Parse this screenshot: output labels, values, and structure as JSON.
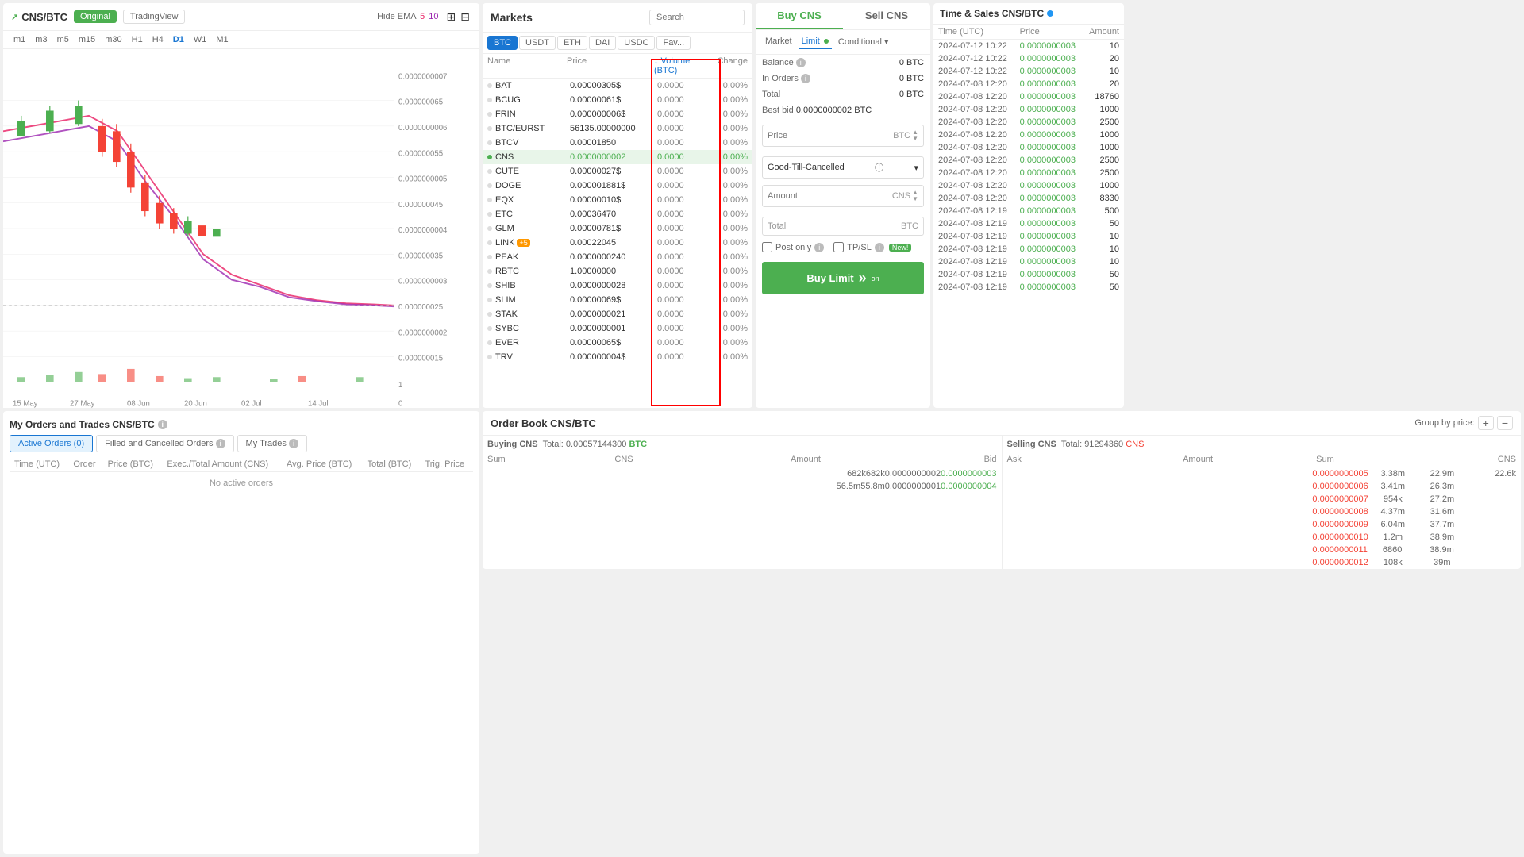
{
  "chart": {
    "symbol": "CNS/BTC",
    "btn_original": "Original",
    "btn_tradingview": "TradingView",
    "hide_ema": "Hide EMA",
    "ema5_label": "5",
    "ema10_label": "10",
    "timeframes": [
      "m1",
      "m5",
      "m5",
      "m15",
      "m30",
      "H1",
      "H4",
      "D1",
      "W1",
      "M1"
    ],
    "active_tf": "D1",
    "price_levels": [
      "0.0000000007",
      "0.000000065",
      "0.0000000006",
      "0.000000055",
      "0.0000000005",
      "0.000000045",
      "0.0000000004",
      "0.000000035",
      "0.0000000003",
      "0.000000025",
      "0.0000000002",
      "0.000000015",
      "1",
      "0"
    ],
    "date_labels": [
      "15 May",
      "27 May",
      "08 Jun",
      "20 Jun",
      "02 Jul",
      "14 Jul"
    ]
  },
  "orders": {
    "title": "My Orders and Trades CNS/BTC",
    "tabs": [
      {
        "label": "Active Orders",
        "count": "0",
        "active": true
      },
      {
        "label": "Filled and Cancelled Orders",
        "count": "",
        "active": false
      },
      {
        "label": "My Trades",
        "count": "",
        "active": false
      }
    ],
    "columns": [
      "Time (UTC)",
      "Order",
      "Price (BTC)",
      "Exec./Total Amount (CNS)",
      "Avg. Price (BTC)",
      "Total (BTC)",
      "Trig. Price"
    ],
    "empty_msg": "No active orders"
  },
  "markets": {
    "title": "Markets",
    "search_placeholder": "Search",
    "tabs": [
      "BTC",
      "USDT",
      "ETH",
      "DAI",
      "USDC",
      "Fav..."
    ],
    "active_tab": "BTC",
    "columns": {
      "name": "Name",
      "price": "Price",
      "volume": "Volume (BTC)",
      "change": "Change"
    },
    "rows": [
      {
        "name": "BAT",
        "price": "0.00000305$",
        "volume": "0.0000",
        "change": "0.00%",
        "selected": false
      },
      {
        "name": "BCUG",
        "price": "0.00000061$",
        "volume": "0.0000",
        "change": "0.00%",
        "selected": false
      },
      {
        "name": "FRIN",
        "price": "0.000000006$",
        "volume": "0.0000",
        "change": "0.00%",
        "selected": false
      },
      {
        "name": "BTC/EURST",
        "price": "56135.00000000",
        "volume": "0.0000",
        "change": "0.00%",
        "selected": false
      },
      {
        "name": "BTCV",
        "price": "0.00001850",
        "volume": "0.0000",
        "change": "0.00%",
        "selected": false
      },
      {
        "name": "CNS",
        "price": "0.0000000002",
        "volume": "0.0000",
        "change": "0.00%",
        "selected": true
      },
      {
        "name": "CUTE",
        "price": "0.00000027$",
        "volume": "0.0000",
        "change": "0.00%",
        "selected": false
      },
      {
        "name": "DOGE",
        "price": "0.000001881$",
        "volume": "0.0000",
        "change": "0.00%",
        "selected": false
      },
      {
        "name": "EQX",
        "price": "0.00000010$",
        "volume": "0.0000",
        "change": "0.00%",
        "selected": false
      },
      {
        "name": "ETC",
        "price": "0.00036470",
        "volume": "0.0000",
        "change": "0.00%",
        "selected": false
      },
      {
        "name": "GLM",
        "price": "0.00000781$",
        "volume": "0.0000",
        "change": "0.00%",
        "selected": false
      },
      {
        "name": "LINK",
        "price": "0.00022045",
        "volume": "0.0000",
        "change": "0.00%",
        "selected": false,
        "badge": "+5"
      },
      {
        "name": "PEAK",
        "price": "0.0000000240",
        "volume": "0.0000",
        "change": "0.00%",
        "selected": false
      },
      {
        "name": "RBTC",
        "price": "1.00000000",
        "volume": "0.0000",
        "change": "0.00%",
        "selected": false
      },
      {
        "name": "SHIB",
        "price": "0.0000000028",
        "volume": "0.0000",
        "change": "0.00%",
        "selected": false
      },
      {
        "name": "SLIM",
        "price": "0.00000069$",
        "volume": "0.0000",
        "change": "0.00%",
        "selected": false
      },
      {
        "name": "STAK",
        "price": "0.0000000021",
        "volume": "0.0000",
        "change": "0.00%",
        "selected": false
      },
      {
        "name": "SYBC",
        "price": "0.0000000001",
        "volume": "0.0000",
        "change": "0.00%",
        "selected": false
      },
      {
        "name": "EVER",
        "price": "0.00000065$",
        "volume": "0.0000",
        "change": "0.00%",
        "selected": false
      },
      {
        "name": "TRV",
        "price": "0.000000004$",
        "volume": "0.0000",
        "change": "0.00%",
        "selected": false
      }
    ]
  },
  "buysell": {
    "buy_label": "Buy CNS",
    "sell_label": "Sell CNS",
    "order_types": [
      "Market",
      "Limit",
      "Conditional"
    ],
    "active_order_type": "Limit",
    "balance_label": "Balance",
    "balance_val": "0 BTC",
    "in_orders_label": "In Orders",
    "in_orders_val": "0 BTC",
    "total_label": "Total",
    "total_val": "0 BTC",
    "best_bid_label": "Best bid",
    "best_bid_val": "0.0000000002 BTC",
    "price_placeholder": "Price",
    "price_currency": "BTC",
    "amount_placeholder": "Amount",
    "amount_currency": "CNS",
    "total_placeholder": "Total",
    "total_currency": "BTC",
    "gtc_label": "Good-Till-Cancelled",
    "post_only": "Post only",
    "tpsl": "TP/SL",
    "new_badge": "New!",
    "buy_btn": "Buy Limit",
    "buy_btn_sub": "on"
  },
  "timesales": {
    "title": "Time & Sales CNS/BTC",
    "columns": [
      "Time (UTC)",
      "Price",
      "Amount"
    ],
    "rows": [
      {
        "time": "2024-07-12 10:22",
        "price": "0.0000000003",
        "amount": "10"
      },
      {
        "time": "2024-07-12 10:22",
        "price": "0.0000000003",
        "amount": "20"
      },
      {
        "time": "2024-07-12 10:22",
        "price": "0.0000000003",
        "amount": "10"
      },
      {
        "time": "2024-07-08 12:20",
        "price": "0.0000000003",
        "amount": "20"
      },
      {
        "time": "2024-07-08 12:20",
        "price": "0.0000000003",
        "amount": "18760"
      },
      {
        "time": "2024-07-08 12:20",
        "price": "0.0000000003",
        "amount": "1000"
      },
      {
        "time": "2024-07-08 12:20",
        "price": "0.0000000003",
        "amount": "2500"
      },
      {
        "time": "2024-07-08 12:20",
        "price": "0.0000000003",
        "amount": "1000"
      },
      {
        "time": "2024-07-08 12:20",
        "price": "0.0000000003",
        "amount": "1000"
      },
      {
        "time": "2024-07-08 12:20",
        "price": "0.0000000003",
        "amount": "2500"
      },
      {
        "time": "2024-07-08 12:20",
        "price": "0.0000000003",
        "amount": "2500"
      },
      {
        "time": "2024-07-08 12:20",
        "price": "0.0000000003",
        "amount": "1000"
      },
      {
        "time": "2024-07-08 12:20",
        "price": "0.0000000003",
        "amount": "8330"
      },
      {
        "time": "2024-07-08 12:19",
        "price": "0.0000000003",
        "amount": "500"
      },
      {
        "time": "2024-07-08 12:19",
        "price": "0.0000000003",
        "amount": "50"
      },
      {
        "time": "2024-07-08 12:19",
        "price": "0.0000000003",
        "amount": "10"
      },
      {
        "time": "2024-07-08 12:19",
        "price": "0.0000000003",
        "amount": "10"
      },
      {
        "time": "2024-07-08 12:19",
        "price": "0.0000000003",
        "amount": "10"
      },
      {
        "time": "2024-07-08 12:19",
        "price": "0.0000000003",
        "amount": "50"
      },
      {
        "time": "2024-07-08 12:19",
        "price": "0.0000000003",
        "amount": "50"
      }
    ]
  },
  "orderbook": {
    "title": "Order Book CNS/BTC",
    "group_price_label": "Group by price:",
    "buying_label": "Buying CNS",
    "selling_label": "Selling CNS",
    "buying_total": "Total: 0.00057144300 BTC",
    "selling_total": "Total: 91294360 CNS",
    "buy_col_headers": [
      "Sum",
      "CNS",
      "Amount",
      "Bid"
    ],
    "sell_col_headers": [
      "Ask",
      "Amount",
      "Sum",
      "CNS"
    ],
    "buy_rows": [
      {
        "sum": "682k",
        "cns": "682k",
        "amount": "0.0000000002",
        "bid": "0.0000000003"
      },
      {
        "sum": "56.5m",
        "cns": "55.8m",
        "amount": "0.0000000001",
        "bid": "0.0000000004"
      }
    ],
    "sell_rows": [
      {
        "ask": "0.0000000005",
        "amount": "3.38m",
        "sum": "22.9m",
        "cns": "22.6k"
      },
      {
        "ask": "0.0000000006",
        "amount": "3.41m",
        "sum": "26.3m",
        "cns": ""
      },
      {
        "ask": "0.0000000007",
        "amount": "954k",
        "sum": "27.2m",
        "cns": ""
      },
      {
        "ask": "0.0000000008",
        "amount": "4.37m",
        "sum": "31.6m",
        "cns": ""
      },
      {
        "ask": "0.0000000009",
        "amount": "6.04m",
        "sum": "37.7m",
        "cns": ""
      },
      {
        "ask": "0.0000000010",
        "amount": "1.2m",
        "sum": "38.9m",
        "cns": ""
      },
      {
        "ask": "0.0000000011",
        "amount": "6860",
        "sum": "38.9m",
        "cns": ""
      },
      {
        "ask": "0.0000000012",
        "amount": "108k",
        "sum": "39m",
        "cns": ""
      }
    ]
  }
}
